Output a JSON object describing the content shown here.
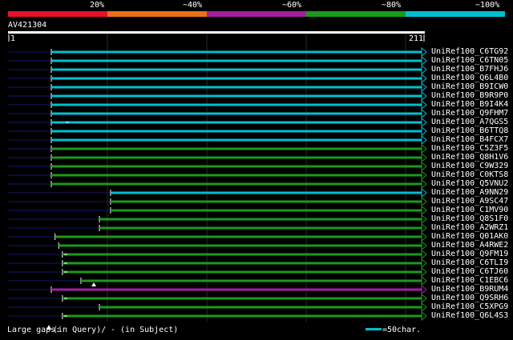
{
  "colors": {
    "background": "#000000",
    "query_line": "#ffffff",
    "cyan": "#00c0d0",
    "green": "#1a9a1a",
    "purple": "#a020a0",
    "navy": "#16166a",
    "scale": [
      "#e8102a",
      "#e8701a",
      "#a020a0",
      "#1a9a1a",
      "#00c0d0"
    ]
  },
  "scale_labels": [
    "20%",
    "~40%",
    "~60%",
    "~80%",
    "~100%"
  ],
  "query": {
    "name": "AV421304",
    "start": "1",
    "end": "211"
  },
  "hits": [
    {
      "name": "UniRef100_C6TG92",
      "color": "cyan",
      "start": 0.0,
      "end": 1.0,
      "left_stub": 0.0
    },
    {
      "name": "UniRef100_C6TN05",
      "color": "cyan",
      "start": 0.0,
      "end": 1.0,
      "left_stub": 0.0
    },
    {
      "name": "UniRef100_B7FHJ6",
      "color": "cyan",
      "start": 0.0,
      "end": 1.0,
      "left_stub": 0.0
    },
    {
      "name": "UniRef100_Q6L4B0",
      "color": "cyan",
      "start": 0.0,
      "end": 1.0,
      "left_stub": 0.0
    },
    {
      "name": "UniRef100_B9ICW0",
      "color": "cyan",
      "start": 0.0,
      "end": 1.0,
      "left_stub": 0.0
    },
    {
      "name": "UniRef100_B9R9P0",
      "color": "cyan",
      "start": 0.0,
      "end": 1.0,
      "left_stub": 0.0
    },
    {
      "name": "UniRef100_B9I4K4",
      "color": "cyan",
      "start": 0.0,
      "end": 1.0,
      "left_stub": 0.0
    },
    {
      "name": "UniRef100_Q9FHM7",
      "color": "cyan",
      "start": 0.0,
      "end": 1.0,
      "left_stub": 0.0
    },
    {
      "name": "UniRef100_A7QGS5",
      "color": "cyan",
      "start": 0.0,
      "end": 1.0,
      "left_stub": 0.0
    },
    {
      "name": "UniRef100_B6TTQ8",
      "color": "cyan",
      "start": 0.0,
      "end": 1.0,
      "left_stub": 0.0
    },
    {
      "name": "UniRef100_B4FCX7",
      "color": "cyan",
      "start": 0.0,
      "end": 1.0,
      "left_stub": 0.0
    },
    {
      "name": "UniRef100_C5Z3F5",
      "color": "green",
      "start": 0.0,
      "end": 1.0,
      "left_stub": 0.0
    },
    {
      "name": "UniRef100_Q8H1V6",
      "color": "green",
      "start": 0.0,
      "end": 1.0,
      "left_stub": 0.0
    },
    {
      "name": "UniRef100_C9W329",
      "color": "green",
      "start": 0.0,
      "end": 1.0,
      "left_stub": 0.0
    },
    {
      "name": "UniRef100_C0KTS8",
      "color": "green",
      "start": 0.0,
      "end": 1.0,
      "left_stub": 0.0
    },
    {
      "name": "UniRef100_Q5VNU2",
      "color": "green",
      "start": 0.0,
      "end": 1.0,
      "left_stub": 0.0
    },
    {
      "name": "UniRef100_A9NN29",
      "color": "cyan",
      "start": 0.16,
      "end": 1.0,
      "left_stub": 0.0
    },
    {
      "name": "UniRef100_A9SC47",
      "color": "green",
      "start": 0.16,
      "end": 1.0,
      "left_stub": 0.0
    },
    {
      "name": "UniRef100_C1MV90",
      "color": "green",
      "start": 0.16,
      "end": 1.0,
      "left_stub": 0.0
    },
    {
      "name": "UniRef100_Q8S1F0",
      "color": "green",
      "start": 0.13,
      "end": 1.0,
      "left_stub": 0.0
    },
    {
      "name": "UniRef100_A2WRZ1",
      "color": "green",
      "start": 0.13,
      "end": 1.0,
      "left_stub": 0.0
    },
    {
      "name": "UniRef100_Q01AK0",
      "color": "green",
      "start": 0.01,
      "end": 1.0,
      "left_stub": 0.0
    },
    {
      "name": "UniRef100_A4RWE2",
      "color": "green",
      "start": 0.02,
      "end": 1.0,
      "left_stub": 0.0
    },
    {
      "name": "UniRef100_Q9FM19",
      "color": "green",
      "start": 0.03,
      "end": 1.0,
      "left_stub": 0.0
    },
    {
      "name": "UniRef100_C6TLI9",
      "color": "green",
      "start": 0.03,
      "end": 1.0,
      "left_stub": 0.0
    },
    {
      "name": "UniRef100_C6TJ60",
      "color": "green",
      "start": 0.03,
      "end": 1.0,
      "left_stub": 0.0
    },
    {
      "name": "UniRef100_C1EBC6",
      "color": "green",
      "start": 0.08,
      "end": 1.0,
      "left_stub": 0.0
    },
    {
      "name": "UniRef100_B9RUM4",
      "color": "purple",
      "start": 0.0,
      "end": 1.0,
      "left_stub": 0.0
    },
    {
      "name": "UniRef100_Q9SRH6",
      "color": "green",
      "start": 0.03,
      "end": 1.0,
      "left_stub": 0.0
    },
    {
      "name": "UniRef100_C5XPG9",
      "color": "green",
      "start": 0.13,
      "end": 1.0,
      "left_stub": 0.0
    },
    {
      "name": "UniRef100_Q6L4S3",
      "color": "green",
      "start": 0.03,
      "end": 1.0,
      "left_stub": 0.0
    }
  ],
  "footer": {
    "gaps_prefix": "Large gaps:",
    "gaps_in_query": "(in Query)/",
    "gaps_in_subject": "- (in Subject)",
    "scale_note": "=50char."
  }
}
